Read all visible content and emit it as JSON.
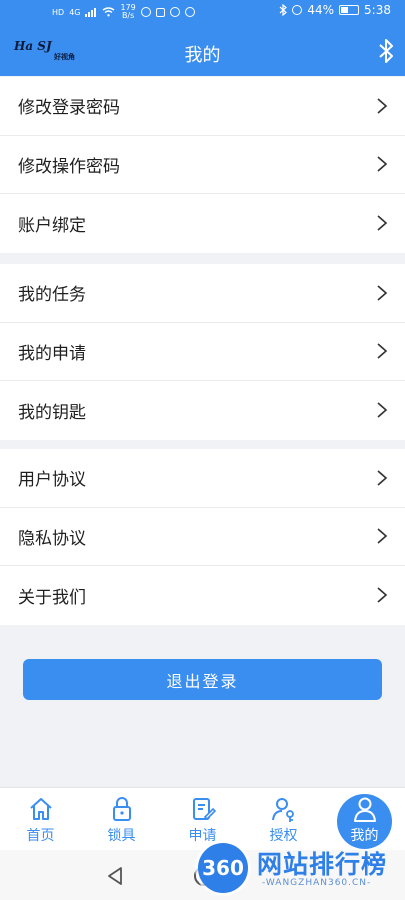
{
  "status_bar": {
    "hd": "HD",
    "network": "4G",
    "speed_value": "179",
    "speed_unit": "B/s",
    "battery": "44%",
    "time": "5:38"
  },
  "header": {
    "logo_main": "Ha SJ",
    "logo_sub": "好视角",
    "title": "我的"
  },
  "menu_groups": [
    [
      "修改登录密码",
      "修改操作密码",
      "账户绑定"
    ],
    [
      "我的任务",
      "我的申请",
      "我的钥匙"
    ],
    [
      "用户协议",
      "隐私协议",
      "关于我们"
    ]
  ],
  "logout_label": "退出登录",
  "tabs": [
    {
      "label": "首页",
      "icon": "home-icon"
    },
    {
      "label": "锁具",
      "icon": "lock-icon"
    },
    {
      "label": "申请",
      "icon": "apply-edit-icon"
    },
    {
      "label": "授权",
      "icon": "authorize-user-icon"
    },
    {
      "label": "我的",
      "icon": "user-icon",
      "active": true
    }
  ],
  "watermark": {
    "badge": "360",
    "name": "网站排行榜",
    "domain": "-WANGZHAN360.CN-"
  },
  "colors": {
    "primary": "#3a8ef0",
    "background": "#f1f2f6",
    "text": "#1f1f1f"
  }
}
